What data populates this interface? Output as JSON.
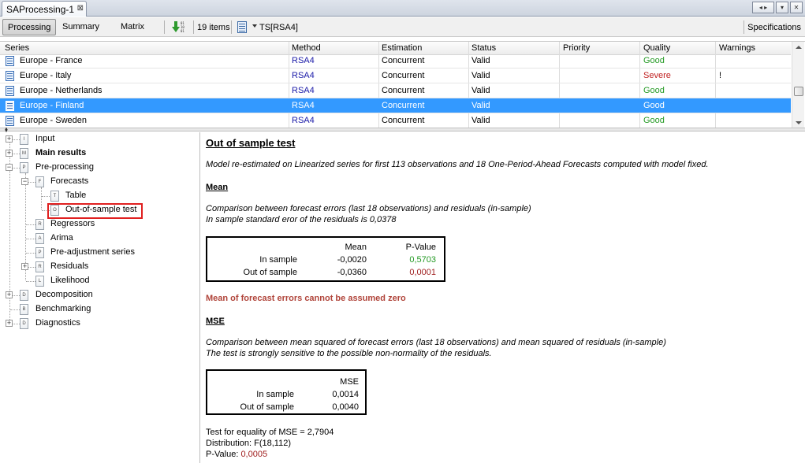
{
  "tab": {
    "title": "SAProcessing-1",
    "close": "⊠"
  },
  "toolbar": {
    "processing": "Processing",
    "summary": "Summary",
    "matrix": "Matrix",
    "items_count": "19 items",
    "ts_label": "TS[RSA4]",
    "specifications": "Specifications"
  },
  "grid": {
    "columns": [
      "Series",
      "Method",
      "Estimation",
      "Status",
      "Priority",
      "Quality",
      "Warnings"
    ],
    "rows": [
      {
        "series": "Europe - France",
        "method": "RSA4",
        "estimation": "Concurrent",
        "status": "Valid",
        "priority": "",
        "quality": "Good",
        "warnings": ""
      },
      {
        "series": "Europe - Italy",
        "method": "RSA4",
        "estimation": "Concurrent",
        "status": "Valid",
        "priority": "",
        "quality": "Severe",
        "warnings": "!"
      },
      {
        "series": "Europe - Netherlands",
        "method": "RSA4",
        "estimation": "Concurrent",
        "status": "Valid",
        "priority": "",
        "quality": "Good",
        "warnings": ""
      },
      {
        "series": "Europe - Finland",
        "method": "RSA4",
        "estimation": "Concurrent",
        "status": "Valid",
        "priority": "",
        "quality": "Good",
        "warnings": ""
      },
      {
        "series": "Europe - Sweden",
        "method": "RSA4",
        "estimation": "Concurrent",
        "status": "Valid",
        "priority": "",
        "quality": "Good",
        "warnings": ""
      }
    ]
  },
  "tree": {
    "input": "Input",
    "main_results": "Main results",
    "pre_processing": "Pre-processing",
    "forecasts": "Forecasts",
    "table": "Table",
    "out_of_sample_test": "Out-of-sample test",
    "regressors": "Regressors",
    "arima": "Arima",
    "pre_adjustment_series": "Pre-adjustment series",
    "residuals": "Residuals",
    "likelihood": "Likelihood",
    "decomposition": "Decomposition",
    "benchmarking": "Benchmarking",
    "diagnostics": "Diagnostics",
    "icons": {
      "input": "I",
      "main_results": "M",
      "pre_processing": "P",
      "forecasts": "F",
      "table": "T",
      "out_of_sample_test": "O",
      "regressors": "R",
      "arima": "A",
      "pre_adjustment_series": "P",
      "residuals": "R",
      "likelihood": "L",
      "decomposition": "D",
      "benchmarking": "B",
      "diagnostics": "D"
    }
  },
  "content": {
    "title": "Out of sample test",
    "intro": "Model re-estimated on Linearized series for first 113 observations and 18 One-Period-Ahead Forecasts computed with model fixed.",
    "mean_heading": "Mean",
    "mean_desc1": "Comparison between forecast errors (last 18 observations) and residuals (in-sample)",
    "mean_desc2": "In sample standard eror of the residuals is 0,0378",
    "mean_table": {
      "h_mean": "Mean",
      "h_pvalue": "P-Value",
      "r1_label": "In sample",
      "r1_mean": "-0,0020",
      "r1_pvalue": "0,5703",
      "r2_label": "Out of sample",
      "r2_mean": "-0,0360",
      "r2_pvalue": "0,0001"
    },
    "mean_warning": "Mean of forecast errors cannot be assumed zero",
    "mse_heading": "MSE",
    "mse_desc1": "Comparison between mean squared of forecast errors (last 18 observations) and mean squared of residuals (in-sample)",
    "mse_desc2": "The test is strongly sensitive to the possible non-normality of the residuals.",
    "mse_table": {
      "h_mse": "MSE",
      "r1_label": "In sample",
      "r1_mse": "0,0014",
      "r2_label": "Out of sample",
      "r2_mse": "0,0040"
    },
    "test_line": "Test for equality of MSE = 2,7904",
    "distribution": "Distribution: F(18,112)",
    "pvalue_label": "P-Value: ",
    "pvalue_value": "0,0005"
  },
  "colors": {
    "selected_row": "#3399ff",
    "good": "#249a24",
    "severe": "#c02020",
    "warning_text": "#b0443a",
    "highlight_box": "#e02020"
  }
}
